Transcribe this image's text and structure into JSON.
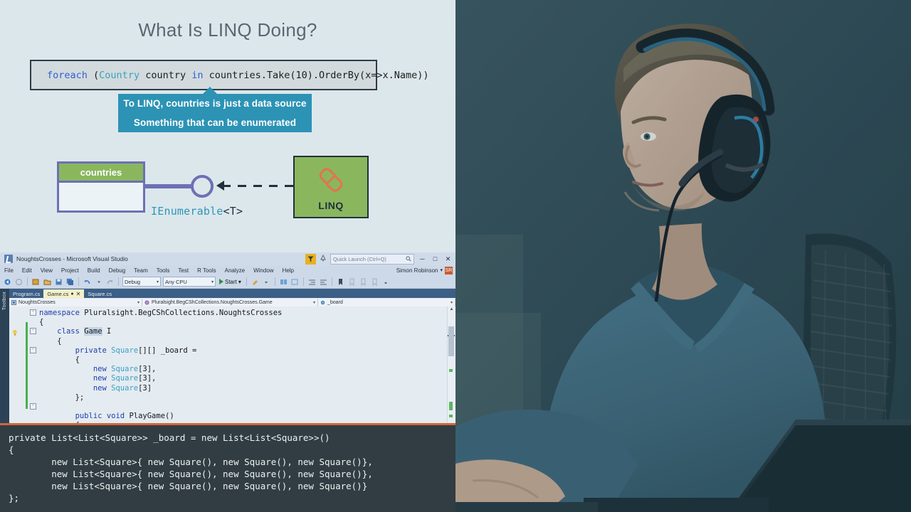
{
  "slide": {
    "title": "What Is LINQ Doing?",
    "code_line": {
      "kw1": "foreach",
      "paren_open": " (",
      "type1": "Country",
      "var1": " country ",
      "kw2": "in",
      "rest": " countries.Take(10).OrderBy(x=>x.Name))"
    },
    "callout": {
      "line1": "To LINQ, countries is just a data source",
      "line2": "Something that can be enumerated"
    },
    "diagram": {
      "source_box_label": "countries",
      "interface_label": "IEnumerable",
      "interface_generic": "<T>",
      "consumer_label": "LINQ",
      "consumer_icon": "chain-link-icon"
    },
    "colors": {
      "background": "#dce7ec",
      "title": "#5c6670",
      "callout": "#2c93b5",
      "green_box": "#8ab75e",
      "purple_border": "#6d70b5",
      "teal_text": "#2f96b4",
      "orange_chain": "#e0764c"
    }
  },
  "vs": {
    "window_title": "NoughtsCrosses - Microsoft Visual Studio",
    "quick_launch_placeholder": "Quick Launch (Ctrl+Q)",
    "user_name": "Simon Robinson",
    "user_initials": "SR",
    "window_buttons": {
      "minimize": "─",
      "maximize": "□",
      "close": "✕"
    },
    "menus": [
      "File",
      "Edit",
      "View",
      "Project",
      "Build",
      "Debug",
      "Team",
      "Tools",
      "Test",
      "R Tools",
      "Analyze",
      "Window",
      "Help"
    ],
    "toolbar": {
      "config": "Debug",
      "platform": "Any CPU",
      "start_label": "Start"
    },
    "toolbox_label": "Toolbox",
    "tabs": [
      {
        "label": "Program.cs",
        "active": false,
        "dirty": false
      },
      {
        "label": "Game.cs",
        "active": true,
        "dirty": true,
        "dirty_glyph": "●",
        "close_glyph": "✕"
      },
      {
        "label": "Square.cs",
        "active": false,
        "dirty": false
      }
    ],
    "nav": {
      "project": "NoughtsCrosses",
      "type": "Pluralsight.BegCShCollections.NoughtsCrosses.Game",
      "member": "_board",
      "caret": "▾"
    },
    "code": {
      "l1_kw": "namespace",
      "l1_rest": " Pluralsight.BegCShCollections.NoughtsCrosses",
      "l2": "{",
      "l3_kw": "class",
      "l3_name": "Game",
      "l4": "    {",
      "l5_kw": "private",
      "l5_type": "Square",
      "l5_rest": "[][] _board =",
      "l6": "        {",
      "l7_kw": "new",
      "l7_type": "Square",
      "l7_rest": "[3],",
      "l8_kw": "new",
      "l8_type": "Square",
      "l8_rest": "[3],",
      "l9_kw": "new",
      "l9_type": "Square",
      "l9_rest": "[3]",
      "l10": "        };",
      "l11_kw": "public void",
      "l11_rest": " PlayGame()",
      "l12": "        {"
    }
  },
  "overlay": {
    "accent_color": "#d2653a",
    "background": "#313d42",
    "code": "private List<List<Square>> _board = new List<List<Square>>()\n{\n        new List<Square>{ new Square(), new Square(), new Square()},\n        new List<Square>{ new Square(), new Square(), new Square()},\n        new List<Square>{ new Square(), new Square(), new Square()}\n};"
  },
  "video": {
    "description": "instructor-webcam-photo"
  }
}
